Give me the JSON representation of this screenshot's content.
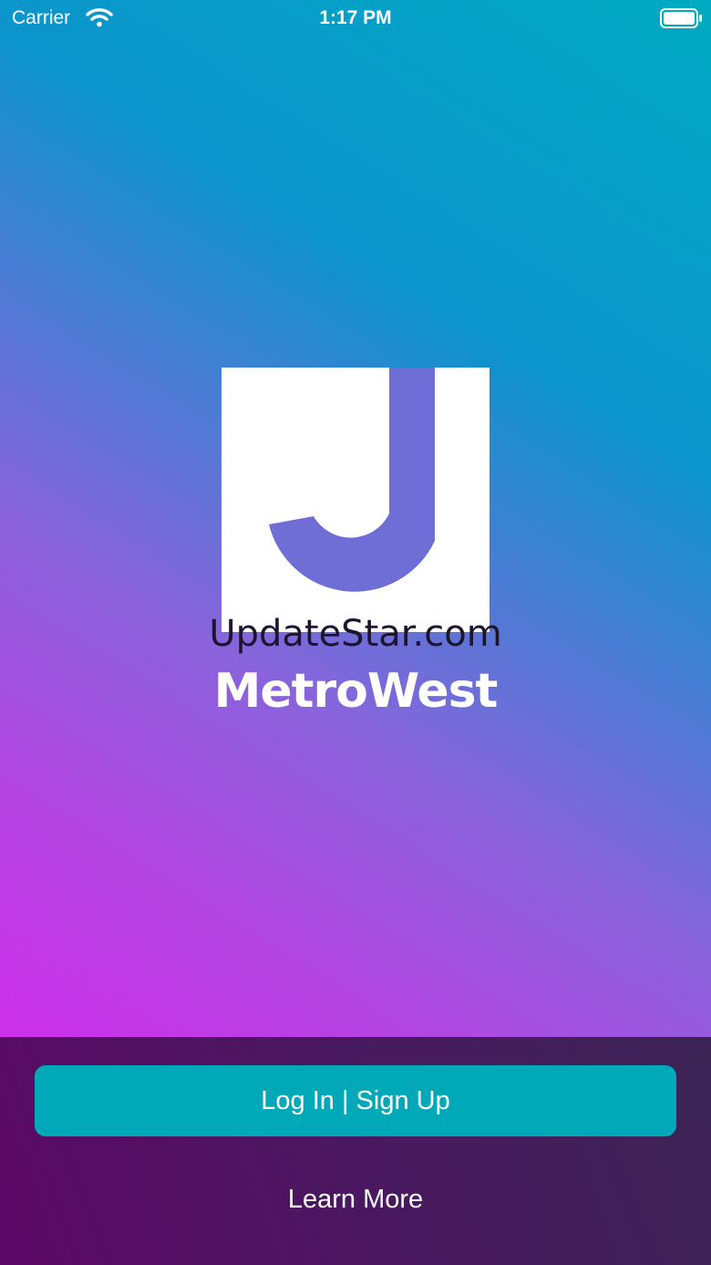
{
  "status_bar": {
    "carrier": "Carrier",
    "time": "1:17 PM",
    "icons": [
      "wifi-icon",
      "battery-icon"
    ]
  },
  "logo": {
    "icon": "j-logo-icon",
    "watermark": "UpdateStar.com",
    "brand_name": "MetroWest"
  },
  "actions": {
    "login_label": "Log In | Sign Up",
    "learn_more_label": "Learn More"
  },
  "colors": {
    "button": "#00a8b8",
    "gradient_start": "#e21df0",
    "gradient_end": "#00aac2",
    "panel": "#4a1860"
  }
}
